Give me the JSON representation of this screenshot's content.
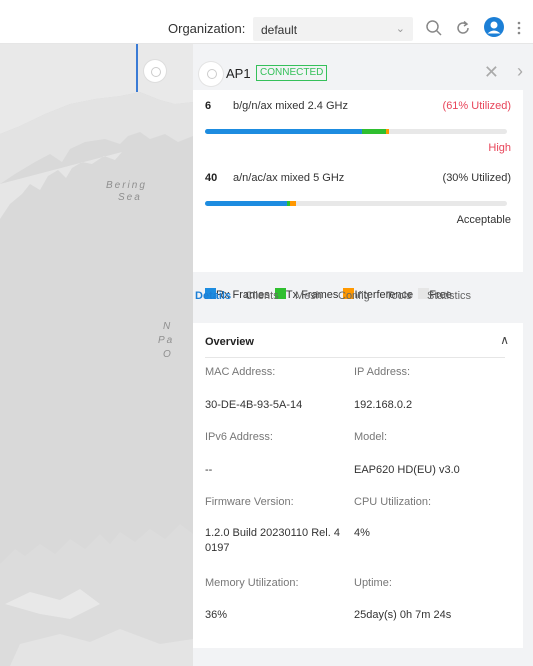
{
  "topbar": {
    "org_label": "Organization:",
    "org_value": "default",
    "icons": [
      "search-icon",
      "refresh-icon",
      "user-avatar-icon",
      "more-vert-icon"
    ]
  },
  "map": {
    "labels": [
      "Bering",
      "Sea",
      "N",
      "Pa",
      "O"
    ]
  },
  "ap": {
    "name": "AP1",
    "status": "CONNECTED",
    "status_color": "#35c05a"
  },
  "radios": [
    {
      "channel": "6",
      "mode": "b/g/n/ax mixed  2.4 GHz",
      "utilization": "(61% Utilized)",
      "util_color": "#e8455a",
      "level": "High",
      "level_color": "#e8455a",
      "rx_pct": 52,
      "tx_pct": 8,
      "interference_pct": 1
    },
    {
      "channel": "40",
      "mode": "a/n/ac/ax mixed  5 GHz",
      "utilization": "(30% Utilized)",
      "util_color": "#333333",
      "level": "Acceptable",
      "level_color": "#333333",
      "rx_pct": 27,
      "tx_pct": 1,
      "interference_pct": 2
    }
  ],
  "legend": {
    "rx": "Rx Frames",
    "tx": "Tx Frames",
    "interference": "Interference",
    "free": "Free",
    "colors": {
      "rx": "#1d8ce0",
      "tx": "#2fbf2f",
      "interference": "#ff9800",
      "free": "#e6e6e6"
    }
  },
  "tabs": [
    "Details",
    "Clients",
    "Mesh",
    "Config",
    "Tools",
    "Statistics"
  ],
  "active_tab": "Details",
  "overview": {
    "title": "Overview",
    "fields": [
      {
        "key": "MAC Address:",
        "value": "30-DE-4B-93-5A-14"
      },
      {
        "key": "IP Address:",
        "value": "192.168.0.2"
      },
      {
        "key": "IPv6 Address:",
        "value": "--"
      },
      {
        "key": "Model:",
        "value": "EAP620 HD(EU) v3.0"
      },
      {
        "key": "Firmware Version:",
        "value": "1.2.0 Build 20230110 Rel. 4\n0197"
      },
      {
        "key": "CPU Utilization:",
        "value": "4%"
      },
      {
        "key": "Memory Utilization:",
        "value": "36%"
      },
      {
        "key": "Uptime:",
        "value": "25day(s) 0h 7m 24s"
      }
    ]
  }
}
